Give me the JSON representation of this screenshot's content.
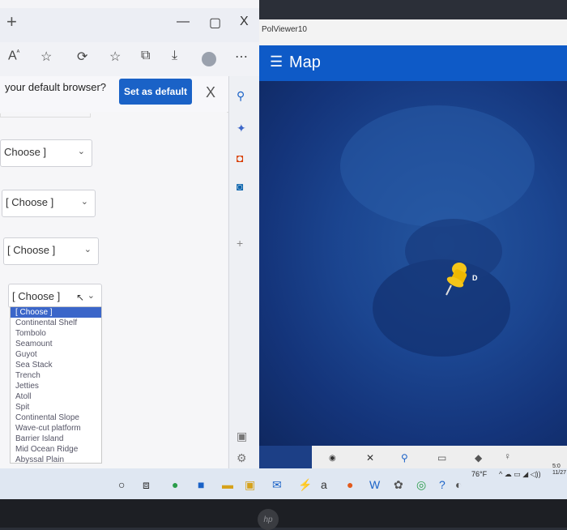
{
  "browser": {
    "infobar": {
      "prompt": "your default browser?",
      "set_default_label": "Set as default",
      "close_glyph": "X"
    },
    "window_controls": {
      "new_tab": "+",
      "minimize": "—",
      "maximize": "▢",
      "close": "X"
    },
    "toolbar_icons": [
      "read-aloud-icon",
      "favorites-add-icon",
      "extensions-icon",
      "favorites-icon",
      "collections-icon",
      "downloads-icon",
      "profile-icon",
      "more-icon"
    ]
  },
  "form": {
    "selects": [
      {
        "value": "Choose ]"
      },
      {
        "value": "[ Choose ]"
      },
      {
        "value": "[ Choose ]"
      },
      {
        "value": "[ Choose ]"
      }
    ],
    "dropdown_options": [
      "[ Choose ]",
      "Continental Shelf",
      "Tombolo",
      "Seamount",
      "Guyot",
      "Sea Stack",
      "Trench",
      "Jetties",
      "Atoll",
      "Spit",
      "Continental Slope",
      "Wave-cut platform",
      "Barrier Island",
      "Mid Ocean Ridge",
      "Abyssal Plain"
    ]
  },
  "map_app": {
    "app_name": "PolViewer10",
    "header_title": "Map",
    "pin_label": "D",
    "pin_color": "#f5c518",
    "header_color": "#0e5ac7"
  },
  "taskbar": {
    "weather": "76°F",
    "clock_time": "5:0",
    "clock_date": "11/27"
  },
  "bezel": {
    "logo": "hp"
  }
}
